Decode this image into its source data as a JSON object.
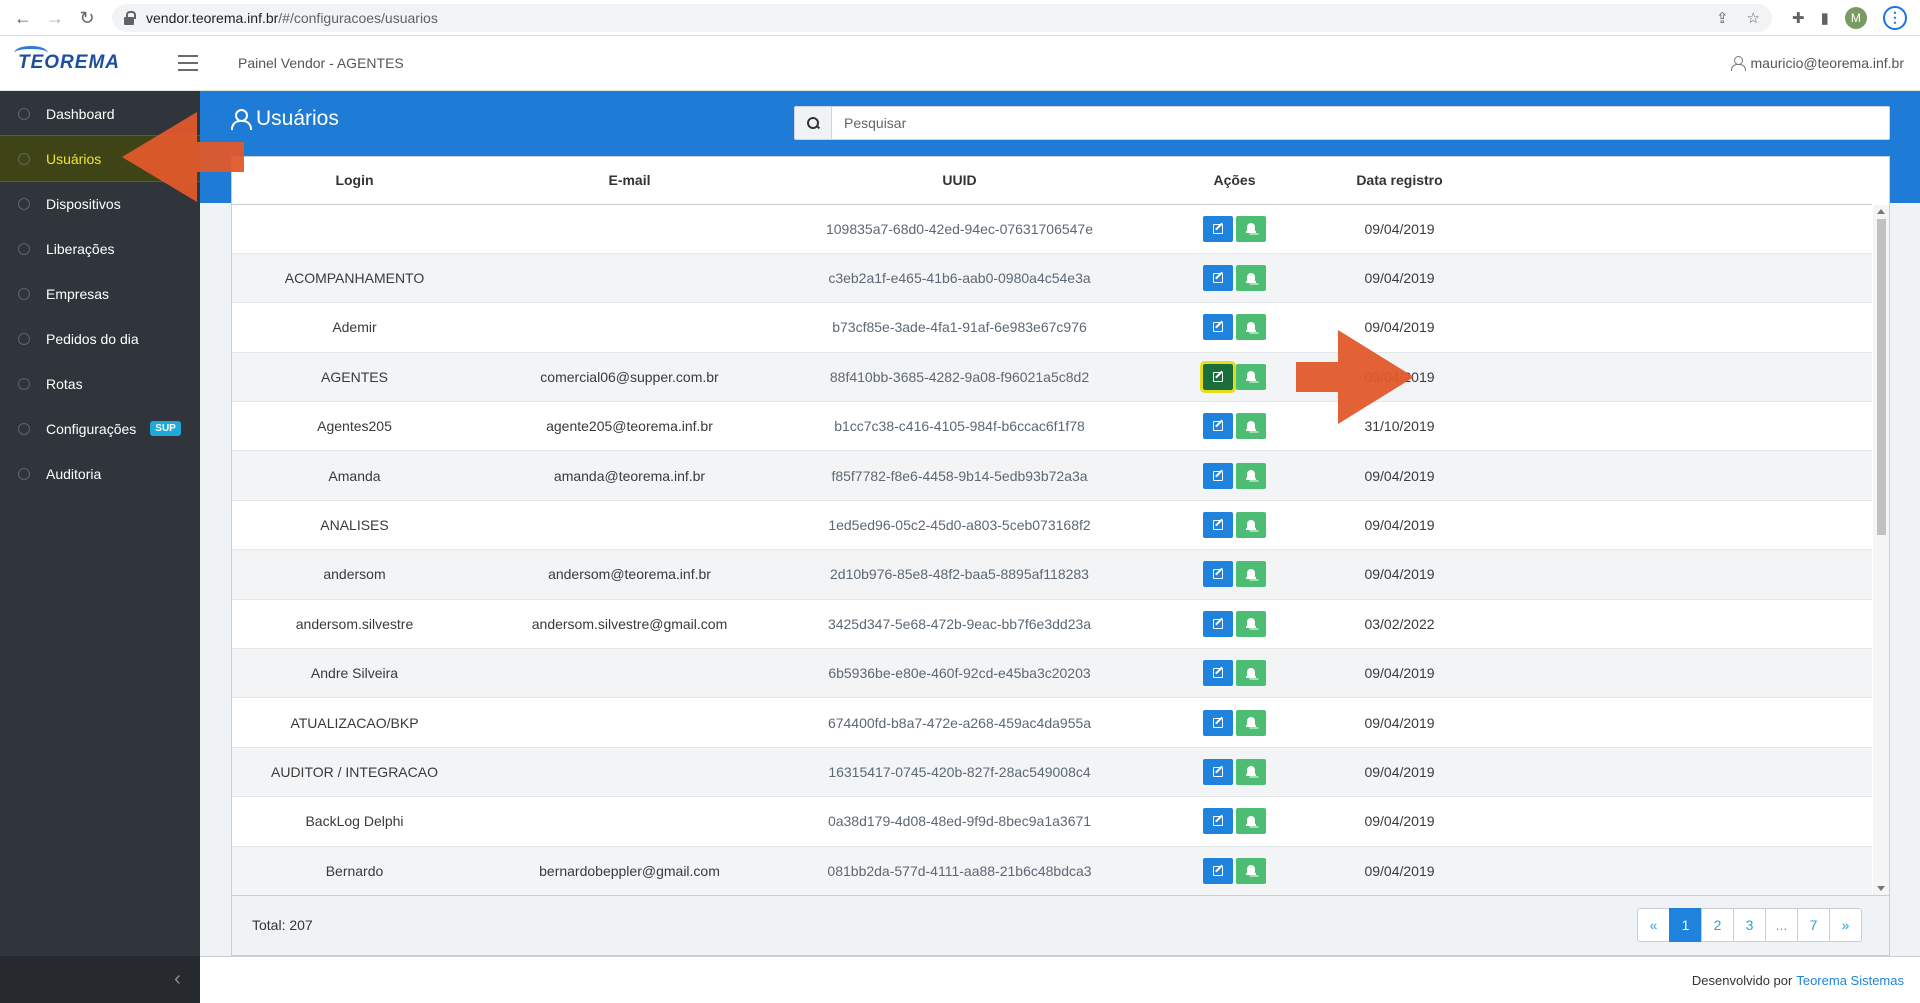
{
  "browser": {
    "url_host": "vendor.teorema.inf.br",
    "url_path": "/#/configuracoes/usuarios",
    "profile_initial": "M"
  },
  "header": {
    "logo": "TEOREMA",
    "title": "Painel Vendor - AGENTES",
    "user_email": "mauricio@teorema.inf.br"
  },
  "sidebar": {
    "items": [
      {
        "label": "Dashboard",
        "icon": "speedometer-icon"
      },
      {
        "label": "Usuários",
        "icon": "user-icon",
        "active": true
      },
      {
        "label": "Dispositivos",
        "icon": "phone-icon"
      },
      {
        "label": "Liberações",
        "icon": "key-icon"
      },
      {
        "label": "Empresas",
        "icon": "briefcase-icon"
      },
      {
        "label": "Pedidos do dia",
        "icon": "bag-icon"
      },
      {
        "label": "Rotas",
        "icon": "location-pin-icon"
      },
      {
        "label": "Configurações",
        "icon": "gear-icon",
        "badge": "SUP"
      },
      {
        "label": "Auditoria",
        "icon": "eye-icon"
      }
    ],
    "collapse_icon": "‹"
  },
  "page": {
    "title": "Usuários",
    "search_placeholder": "Pesquisar"
  },
  "table": {
    "columns": [
      "Login",
      "E-mail",
      "UUID",
      "Ações",
      "Data registro"
    ],
    "rows": [
      {
        "login": "",
        "email": "",
        "uuid": "109835a7-68d0-42ed-94ec-07631706547e",
        "date": "09/04/2019"
      },
      {
        "login": "ACOMPANHAMENTO",
        "email": "",
        "uuid": "c3eb2a1f-e465-41b6-aab0-0980a4c54e3a",
        "date": "09/04/2019"
      },
      {
        "login": "Ademir",
        "email": "",
        "uuid": "b73cf85e-3ade-4fa1-91af-6e983e67c976",
        "date": "09/04/2019"
      },
      {
        "login": "AGENTES",
        "email": "comercial06@supper.com.br",
        "uuid": "88f410bb-3685-4282-9a08-f96021a5c8d2",
        "date": "09/04/2019",
        "highlight": true
      },
      {
        "login": "Agentes205",
        "email": "agente205@teorema.inf.br",
        "uuid": "b1cc7c38-c416-4105-984f-b6ccac6f1f78",
        "date": "31/10/2019"
      },
      {
        "login": "Amanda",
        "email": "amanda@teorema.inf.br",
        "uuid": "f85f7782-f8e6-4458-9b14-5edb93b72a3a",
        "date": "09/04/2019"
      },
      {
        "login": "ANALISES",
        "email": "",
        "uuid": "1ed5ed96-05c2-45d0-a803-5ceb073168f2",
        "date": "09/04/2019"
      },
      {
        "login": "andersom",
        "email": "andersom@teorema.inf.br",
        "uuid": "2d10b976-85e8-48f2-baa5-8895af118283",
        "date": "09/04/2019"
      },
      {
        "login": "andersom.silvestre",
        "email": "andersom.silvestre@gmail.com",
        "uuid": "3425d347-5e68-472b-9eac-bb7f6e3dd23a",
        "date": "03/02/2022"
      },
      {
        "login": "Andre Silveira",
        "email": "",
        "uuid": "6b5936be-e80e-460f-92cd-e45ba3c20203",
        "date": "09/04/2019"
      },
      {
        "login": "ATUALIZACAO/BKP",
        "email": "",
        "uuid": "674400fd-b8a7-472e-a268-459ac4da955a",
        "date": "09/04/2019"
      },
      {
        "login": "AUDITOR / INTEGRACAO",
        "email": "",
        "uuid": "16315417-0745-420b-827f-28ac549008c4",
        "date": "09/04/2019"
      },
      {
        "login": "BackLog Delphi",
        "email": "",
        "uuid": "0a38d179-4d08-48ed-9f9d-8bec9a1a3671",
        "date": "09/04/2019"
      },
      {
        "login": "Bernardo",
        "email": "bernardobeppler@gmail.com",
        "uuid": "081bb2da-577d-4111-aa88-21b6c48bdca3",
        "date": "09/04/2019"
      }
    ]
  },
  "footer": {
    "total": "Total: 207",
    "pages": [
      "«",
      "1",
      "2",
      "3",
      "...",
      "7",
      "»"
    ],
    "active_page": "1",
    "credit_prefix": "Desenvolvido por",
    "credit_link": "Teorema Sistemas"
  },
  "colors": {
    "primary": "#1e7bd6",
    "success": "#4dbd74",
    "sidebar": "#2f353a",
    "annotation_arrow": "#e05a2b",
    "highlight": "#e6dc1a"
  }
}
